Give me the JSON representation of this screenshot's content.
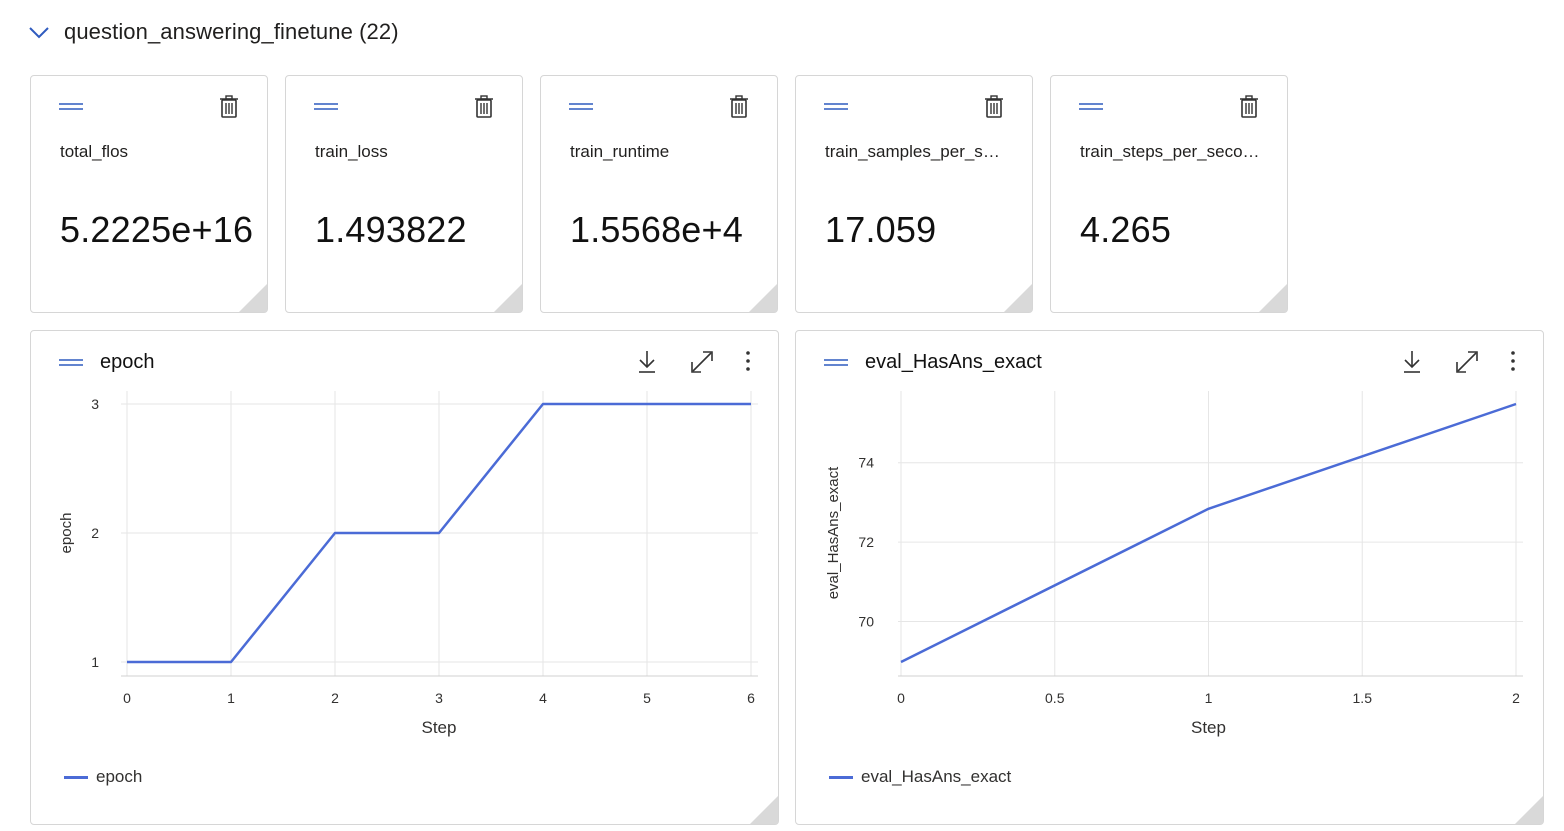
{
  "section": {
    "title": "question_answering_finetune (22)",
    "icon": "chevron-down-icon"
  },
  "tiles": [
    {
      "label": "total_flos",
      "value": "5.2225e+16"
    },
    {
      "label": "train_loss",
      "value": "1.493822"
    },
    {
      "label": "train_runtime",
      "value": "1.5568e+4"
    },
    {
      "label": "train_samples_per_sec...",
      "value": "17.059"
    },
    {
      "label": "train_steps_per_second",
      "value": "4.265"
    }
  ],
  "colors": {
    "series": "#4b6bd6",
    "handle": "#2f5bbf",
    "grid": "#e6e6e6",
    "border": "#d6d6d6"
  },
  "charts": [
    {
      "title": "epoch",
      "legend": "epoch",
      "icons": [
        "download-icon",
        "expand-icon",
        "more-icon"
      ]
    },
    {
      "title": "eval_HasAns_exact",
      "legend": "eval_HasAns_exact",
      "icons": [
        "download-icon",
        "expand-icon",
        "more-icon"
      ]
    }
  ],
  "chart_data": [
    {
      "type": "line",
      "title": "",
      "xlabel": "Step",
      "ylabel": "epoch",
      "x": [
        0,
        1,
        2,
        3,
        4,
        5,
        6
      ],
      "series": [
        {
          "name": "epoch",
          "values": [
            1,
            1,
            2,
            2,
            3,
            3,
            3
          ]
        }
      ],
      "xticks": [
        "0",
        "1",
        "2",
        "3",
        "4",
        "5",
        "6"
      ],
      "yticks": [
        "1",
        "2",
        "3"
      ],
      "xlim": [
        0,
        6
      ],
      "ylim": [
        1,
        3
      ],
      "grid": true,
      "legend": "bottom-left"
    },
    {
      "type": "line",
      "title": "",
      "xlabel": "Step",
      "ylabel": "eval_HasAns_exact",
      "x": [
        0,
        1,
        2
      ],
      "series": [
        {
          "name": "eval_HasAns_exact",
          "values": [
            68.98,
            72.84,
            75.48
          ]
        }
      ],
      "xticks": [
        "0",
        "0.5",
        "1",
        "1.5",
        "2"
      ],
      "yticks": [
        "70",
        "72",
        "74"
      ],
      "xlim": [
        0,
        2
      ],
      "ylim": [
        68.98,
        75.48
      ],
      "grid": true,
      "legend": "bottom-left"
    }
  ]
}
